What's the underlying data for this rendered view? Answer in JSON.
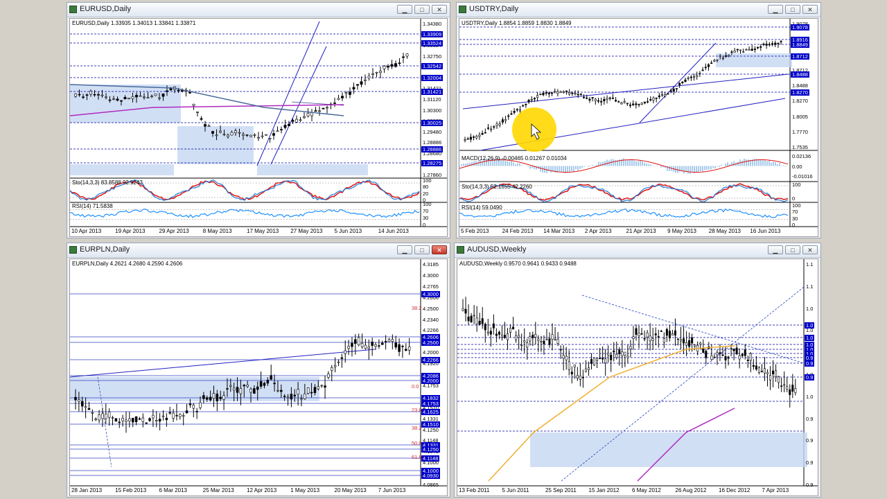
{
  "colors": {
    "accent": "#0000ff",
    "highlight": "#ffd700",
    "panel_bg": "#c6d7f2",
    "ma_purple": "#b02ac0",
    "ma_orange": "#f0b030",
    "ma_steel": "#4a6a9a"
  },
  "windows": [
    {
      "id": "eurusd",
      "title": "EURUSD,Daily",
      "info": "EURUSD,Daily  1.33935 1.34013 1.33841 1.33871",
      "ind1": "Sto(14,3,3) 83.8588 92.9243",
      "ind2": "RSI(14) 71.5838",
      "price_scale": [
        "1.34380",
        "1.33909",
        "1.33524",
        "1.32750",
        "1.32542",
        "1.32004",
        "1.31421",
        "1.31120",
        "1.30300",
        "1.30025",
        "1.29480",
        "1.28886",
        "1.28680",
        "1.28275",
        "1.27860"
      ],
      "price_tags": [
        "1.33909",
        "1.33524",
        "1.32542",
        "1.32004",
        "1.31421",
        "1.30025",
        "1.28886",
        "1.28275"
      ],
      "ind1_scale": [
        "100",
        "80",
        "20",
        "0"
      ],
      "ind2_scale": [
        "100",
        "70",
        "30",
        "0"
      ],
      "dates": [
        "10 Apr 2013",
        "19 Apr 2013",
        "29 Apr 2013",
        "8 May 2013",
        "17 May 2013",
        "27 May 2013",
        "5 Jun 2013",
        "14 Jun 2013"
      ],
      "close_state": "normal"
    },
    {
      "id": "usdtry",
      "title": "USDTRY,Daily",
      "info": "USDTRY,Daily  1.8854 1.8859 1.8830 1.8849",
      "ind1": "MACD(12,26,9) -0.00465 0.01267 0.01034",
      "ind2": "Sto(14,3,3) 52.1655 42.2260",
      "ind3": "RSI(14) 59.0490",
      "price_scale": [
        "1.9078",
        "1.8916",
        "1.8849",
        "1.8712",
        "1.8488",
        "1.8270",
        "1.8005",
        "1.7770",
        "1.7535"
      ],
      "price_tags": [
        "1.9078",
        "1.8916",
        "1.8849",
        "1.8712",
        "1.8488",
        "1.8270"
      ],
      "macd_scale": [
        "0.02136",
        "0.00",
        "-0.01016"
      ],
      "ind2_scale": [
        "100",
        "0"
      ],
      "ind3_scale": [
        "100",
        "70",
        "30",
        "0"
      ],
      "dates": [
        "5 Feb 2013",
        "24 Feb 2013",
        "14 Mar 2013",
        "2 Apr 2013",
        "21 Apr 2013",
        "9 May 2013",
        "28 May 2013",
        "16 Jun 2013"
      ],
      "close_state": "normal"
    },
    {
      "id": "eurpln",
      "title": "EURPLN,Daily",
      "info": "EURPLN,Daily  4.2621 4.2680 4.2590 4.2606",
      "price_scale": [
        "4.3185",
        "4.3000",
        "4.2765",
        "4.2606",
        "4.2500",
        "4.2340",
        "4.2266",
        "4.2086",
        "4.2000",
        "4.1920",
        "4.1832",
        "4.1753",
        "4.1625",
        "4.1510",
        "4.1331",
        "4.1250",
        "4.1148",
        "4.1075",
        "4.1000",
        "4.0930",
        "4.0865"
      ],
      "price_tags": [
        "4.3000",
        "4.2606",
        "4.2500",
        "4.2266",
        "4.2086",
        "4.2000",
        "4.1832",
        "4.1753",
        "4.1625",
        "4.1510",
        "4.1331",
        "4.1250",
        "4.1148",
        "4.1000",
        "4.0930"
      ],
      "fib_labels": [
        "38.2",
        "0.0",
        "23.6",
        "38.2",
        "50.0",
        "61.8"
      ],
      "dates": [
        "28 Jan 2013",
        "15 Feb 2013",
        "6 Mar 2013",
        "25 Mar 2013",
        "12 Apr 2013",
        "1 May 2013",
        "20 May 2013",
        "7 Jun 2013"
      ],
      "close_state": "active"
    },
    {
      "id": "audusd",
      "title": "AUDUSD,Weekly",
      "info": "AUDUSD,Weekly  0.9570 0.9641 0.9433 0.9488",
      "price_scale": [
        "1.1",
        "1.1",
        "1.0",
        "1.0",
        "1.0",
        "1.0",
        "1.0",
        "0.9",
        "0.9",
        "0.9",
        "0.9"
      ],
      "price_tags": [
        "1.0",
        "1.0",
        "1.0",
        "1.0",
        "1.0",
        "0.9",
        "0.9",
        "0.9"
      ],
      "dates": [
        "13 Feb 2011",
        "5 Jun 2011",
        "25 Sep 2011",
        "15 Jan 2012",
        "6 May 2012",
        "26 Aug 2012",
        "16 Dec 2012",
        "7 Apr 2013"
      ],
      "close_state": "normal"
    }
  ]
}
